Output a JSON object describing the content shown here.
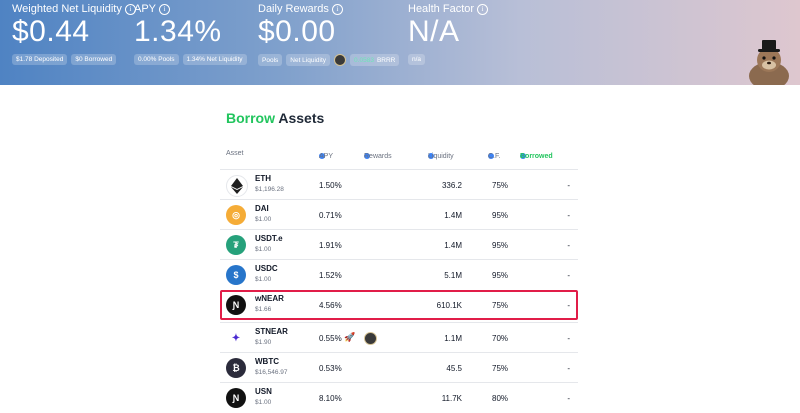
{
  "header": {
    "metrics": [
      {
        "label": "Weighted Net Liquidity",
        "value": "$0.44"
      },
      {
        "label": "APY",
        "value": "1.34%"
      },
      {
        "label": "Daily Rewards",
        "value": "$0.00"
      },
      {
        "label": "Health Factor",
        "value": "N/A"
      }
    ],
    "liquidity_chips": [
      "$1.78 Deposited",
      "$0 Borrowed"
    ],
    "apy_chips": [
      "0.00% Pools",
      "1.34% Net Liquidity"
    ],
    "rewards_chips": {
      "pools": "Pools",
      "net_liquidity": "Net Liquidity",
      "amount": "0.0583",
      "token": "BRRR"
    },
    "health_chip": "n/a"
  },
  "section": {
    "title_accent": "Borrow",
    "title_rest": "Assets"
  },
  "table": {
    "columns": {
      "asset": "Asset",
      "apy": "APY",
      "rewards": "Rewards",
      "liquidity": "Liquidity",
      "cf": "C.F.",
      "borrowed": "Borrowed"
    },
    "rows": [
      {
        "symbol": "ETH",
        "price": "$1,196.28",
        "apy": "1.50%",
        "liquidity": "336.2",
        "cf": "75%",
        "borrowed": "-",
        "icon": "eth-icon",
        "color": "#1f1f1f"
      },
      {
        "symbol": "DAI",
        "price": "$1.00",
        "apy": "0.71%",
        "liquidity": "1.4M",
        "cf": "95%",
        "borrowed": "-",
        "icon": "dai-icon",
        "color": "#f5ac37"
      },
      {
        "symbol": "USDT.e",
        "price": "$1.00",
        "apy": "1.91%",
        "liquidity": "1.4M",
        "cf": "95%",
        "borrowed": "-",
        "icon": "usdt-icon",
        "color": "#26a17b"
      },
      {
        "symbol": "USDC",
        "price": "$1.00",
        "apy": "1.52%",
        "liquidity": "5.1M",
        "cf": "95%",
        "borrowed": "-",
        "icon": "usdc-icon",
        "color": "#2775ca"
      },
      {
        "symbol": "wNEAR",
        "price": "$1.66",
        "apy": "4.56%",
        "liquidity": "610.1K",
        "cf": "75%",
        "borrowed": "-",
        "icon": "near-icon",
        "color": "#111111"
      },
      {
        "symbol": "STNEAR",
        "price": "$1.90",
        "apy": "0.55%",
        "liquidity": "1.1M",
        "cf": "70%",
        "borrowed": "-",
        "icon": "stnear-icon",
        "color": "#ffffff"
      },
      {
        "symbol": "WBTC",
        "price": "$16,546.97",
        "apy": "0.53%",
        "liquidity": "45.5",
        "cf": "75%",
        "borrowed": "-",
        "icon": "wbtc-icon",
        "color": "#2b2b3b"
      },
      {
        "symbol": "USN",
        "price": "$1.00",
        "apy": "8.10%",
        "liquidity": "11.7K",
        "cf": "80%",
        "borrowed": "-",
        "icon": "usn-icon",
        "color": "#111111"
      }
    ]
  }
}
